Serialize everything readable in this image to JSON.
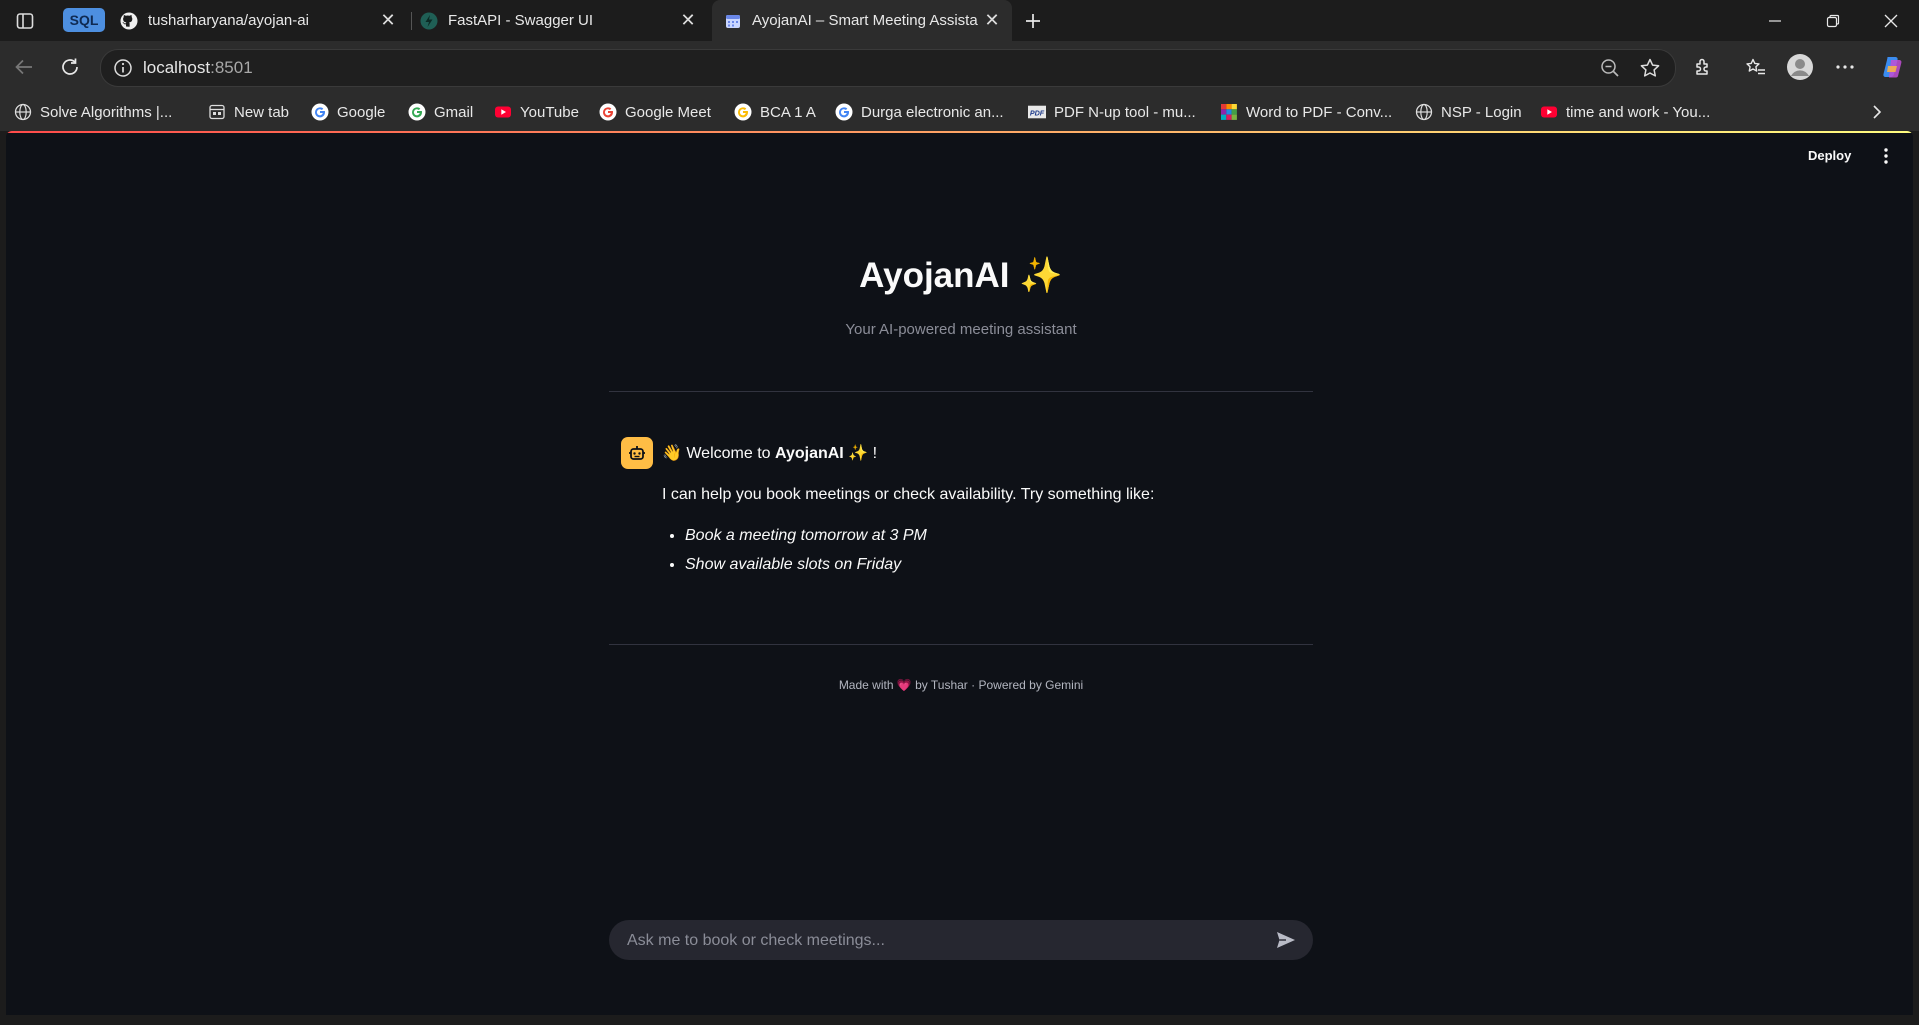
{
  "browser": {
    "tabs": [
      {
        "badge": "SQL"
      },
      {
        "title": "tusharharyana/ayojan-ai",
        "icon": "github-icon"
      },
      {
        "title": "FastAPI - Swagger UI",
        "icon": "fastapi-icon"
      },
      {
        "title": "AyojanAI – Smart Meeting Assista",
        "icon": "calendar-icon",
        "active": true
      }
    ],
    "address": {
      "host": "localhost",
      "port": ":8501"
    },
    "bookmarks": [
      {
        "label": "Solve Algorithms |...",
        "icon": "globe-icon"
      },
      {
        "label": "New tab",
        "icon": "newtab-icon"
      },
      {
        "label": "Google",
        "icon": "google-icon"
      },
      {
        "label": "Gmail",
        "icon": "google-icon"
      },
      {
        "label": "YouTube",
        "icon": "youtube-icon"
      },
      {
        "label": "Google Meet",
        "icon": "google-icon"
      },
      {
        "label": "BCA 1 A",
        "icon": "google-icon"
      },
      {
        "label": "Durga electronic an...",
        "icon": "google-icon"
      },
      {
        "label": "PDF N-up tool - mu...",
        "icon": "pdf-icon"
      },
      {
        "label": "Word to PDF - Conv...",
        "icon": "colorgrid-icon"
      },
      {
        "label": "NSP - Login",
        "icon": "globe-icon"
      },
      {
        "label": "time and work - You...",
        "icon": "youtube-icon"
      }
    ]
  },
  "streamlit": {
    "deploy_label": "Deploy"
  },
  "app": {
    "title": "AyojanAI ✨",
    "subtitle": "Your AI-powered meeting assistant",
    "message": {
      "welcome_prefix": "👋 Welcome to ",
      "welcome_name": "AyojanAI",
      "welcome_suffix": " ✨ !",
      "intro": "I can help you book meetings or check availability. Try something like:",
      "examples": [
        "Book a meeting tomorrow at 3 PM",
        "Show available slots on Friday"
      ]
    },
    "footer": "Made with 💗 by Tushar · Powered by Gemini",
    "input_placeholder": "Ask me to book or check meetings..."
  },
  "colors": {
    "page_bg": "#0e1117",
    "avatar_bg": "#ffbd45",
    "browser_chrome": "#2c2c2c"
  }
}
